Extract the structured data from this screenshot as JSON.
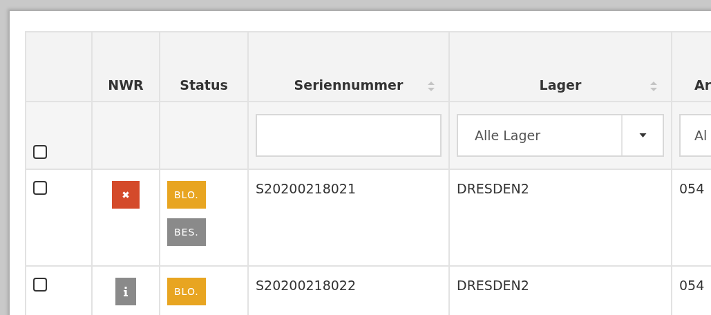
{
  "table": {
    "columns": [
      {},
      {
        "label": "NWR",
        "sortable": false
      },
      {
        "label": "Status",
        "sortable": false
      },
      {
        "label": "Seriennummer",
        "sortable": true
      },
      {
        "label": "Lager",
        "sortable": true
      },
      {
        "label": "Ar",
        "sortable": false
      }
    ],
    "select_all": {
      "checked": false
    },
    "filters": [
      {
        "kind": "none"
      },
      {
        "kind": "none"
      },
      {
        "kind": "text"
      },
      {
        "kind": "select",
        "value": "Alle Lager"
      },
      {
        "kind": "select_cut",
        "value": "Al"
      }
    ],
    "rows": [
      {
        "checked": false,
        "nwr": {
          "kind": "error"
        },
        "status": [
          {
            "label": "BLO.",
            "color": "#e8a521"
          },
          {
            "label": "BES.",
            "color": "#8a8a8a"
          }
        ],
        "serial": "S20200218021",
        "lager": "DRESDEN2",
        "column_6": "054"
      },
      {
        "checked": false,
        "nwr": {
          "kind": "info"
        },
        "status": [
          {
            "label": "BLO.",
            "color": "#e8a521"
          }
        ],
        "serial": "S20200218022",
        "lager": "DRESDEN2",
        "column_6": "054"
      }
    ]
  }
}
